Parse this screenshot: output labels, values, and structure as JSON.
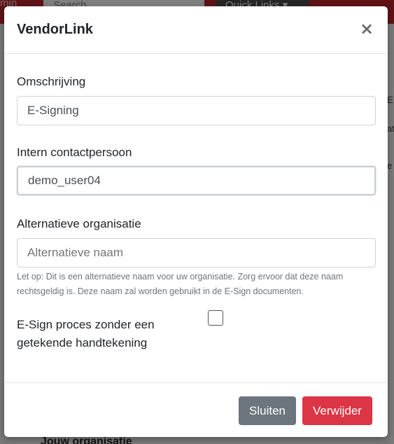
{
  "background": {
    "left_fragment": "min",
    "search_placeholder": "Search",
    "quick_links_label": "Quick Links ▾",
    "bottom_text": "Jouw organisatie",
    "right_fragments": [
      "E",
      "at",
      "e"
    ]
  },
  "modal": {
    "title": "VendorLink",
    "close_symbol": "×",
    "fields": {
      "description": {
        "label": "Omschrijving",
        "value": "E-Signing"
      },
      "internal_contact": {
        "label": "Intern contactpersoon",
        "value": "demo_user04"
      },
      "alt_org": {
        "label": "Alternatieve organisatie",
        "placeholder": "Alternatieve naam",
        "help": "Let op: Dit is een alternatieve naam voor uw organisatie. Zorg ervoor dat deze naam rechtsgeldig is. Deze naam zal worden gebruikt in de E-Sign documenten."
      },
      "no_signature": {
        "label": "E-Sign proces zonder een getekende handtekening",
        "checked": false
      }
    },
    "footer": {
      "close_label": "Sluiten",
      "delete_label": "Verwijder"
    }
  },
  "colors": {
    "topbar": "#c0262d",
    "secondary_button": "#6c757d",
    "danger_button": "#dc3545"
  }
}
